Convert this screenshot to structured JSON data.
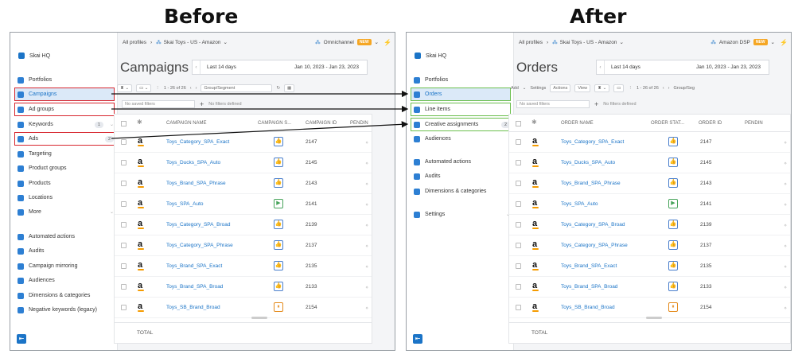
{
  "headings": {
    "before": "Before",
    "after": "After"
  },
  "before": {
    "org": "Skai HQ",
    "sidebar": [
      {
        "label": "Portfolios",
        "icon": "briefcase-icon"
      },
      {
        "label": "Campaigns",
        "icon": "folder-icon",
        "active": true
      },
      {
        "label": "Ad groups",
        "icon": "folders-icon"
      },
      {
        "label": "Keywords",
        "icon": "keyword-icon",
        "count": "1"
      },
      {
        "label": "Ads",
        "icon": "megaphone-icon",
        "count": "2"
      },
      {
        "label": "Targeting",
        "icon": "target-icon"
      },
      {
        "label": "Product groups",
        "icon": "hierarchy-icon"
      },
      {
        "label": "Products",
        "icon": "box-icon"
      },
      {
        "label": "Locations",
        "icon": "pin-icon"
      },
      {
        "label": "More",
        "icon": "more-icon"
      },
      {
        "label": "Automated actions",
        "icon": "robot-icon"
      },
      {
        "label": "Audits",
        "icon": "audit-icon"
      },
      {
        "label": "Campaign mirroring",
        "icon": "mirror-icon"
      },
      {
        "label": "Audiences",
        "icon": "audience-icon"
      },
      {
        "label": "Dimensions & categories",
        "icon": "tag-icon"
      },
      {
        "label": "Negative keywords (legacy)",
        "icon": "negative-icon"
      }
    ],
    "topbar": {
      "all_profiles": "All profiles",
      "account": "Skai Toys - US - Amazon",
      "channel": "Omnichannel",
      "new_badge": "NEW"
    },
    "title": "Campaigns",
    "date": {
      "preset": "Last 14 days",
      "range": "Jan 10, 2023 - Jan 23, 2023"
    },
    "toolbar": {
      "pager": "1 - 26 of 26",
      "group": "Group/Segment"
    },
    "filters": {
      "saved": "No saved filters",
      "defined": "No filters defined"
    },
    "columns": {
      "name": "CAMPAIGN NAME",
      "status": "CAMPAIGN S...",
      "id": "CAMPAIGN ID",
      "pending": "PENDIN"
    },
    "rows": [
      {
        "name": "Toys_Category_SPA_Exact",
        "id": "2147",
        "status": "thumb"
      },
      {
        "name": "Toys_Ducks_SPA_Auto",
        "id": "2145",
        "status": "thumb"
      },
      {
        "name": "Toys_Brand_SPA_Phrase",
        "id": "2143",
        "status": "thumb"
      },
      {
        "name": "Toys_SPA_Auto",
        "id": "2141",
        "status": "play"
      },
      {
        "name": "Toys_Category_SPA_Broad",
        "id": "2139",
        "status": "thumb"
      },
      {
        "name": "Toys_Category_SPA_Phrase",
        "id": "2137",
        "status": "thumb"
      },
      {
        "name": "Toys_Brand_SPA_Exact",
        "id": "2135",
        "status": "thumb"
      },
      {
        "name": "Toys_Brand_SPA_Broad",
        "id": "2133",
        "status": "thumb"
      },
      {
        "name": "Toys_SB_Brand_Broad",
        "id": "2154",
        "status": "pause"
      }
    ],
    "total": "TOTAL"
  },
  "after": {
    "org": "Skai HQ",
    "sidebar": [
      {
        "label": "Portfolios",
        "icon": "briefcase-icon"
      },
      {
        "label": "Orders",
        "icon": "folder-icon",
        "active": true
      },
      {
        "label": "Line items",
        "icon": "folders-icon"
      },
      {
        "label": "Creative assignments",
        "icon": "megaphone-icon",
        "count": "2"
      },
      {
        "label": "Audiences",
        "icon": "audience-icon"
      },
      {
        "label": "Automated actions",
        "icon": "robot-icon"
      },
      {
        "label": "Audits",
        "icon": "audit-icon"
      },
      {
        "label": "Dimensions & categories",
        "icon": "tag-icon"
      },
      {
        "label": "Settings",
        "icon": "settings-icon"
      }
    ],
    "topbar": {
      "all_profiles": "All profiles",
      "account": "Skai Toys - US - Amazon",
      "channel": "Amazon DSP",
      "new_badge": "NEW"
    },
    "title": "Orders",
    "date": {
      "preset": "Last 14 days",
      "range": "Jan 10, 2023 - Jan 23, 2023"
    },
    "toolbar": {
      "add": "Add",
      "settings": "Settings",
      "actions": "Actions",
      "view": "View",
      "pager": "1 - 26 of 26",
      "group": "Group/Seg"
    },
    "filters": {
      "saved": "No saved filters",
      "defined": "No filters defined"
    },
    "columns": {
      "name": "ORDER NAME",
      "status": "ORDER STAT...",
      "id": "ORDER ID",
      "pending": "PENDIN"
    },
    "rows": [
      {
        "name": "Toys_Category_SPA_Exact",
        "id": "2147",
        "status": "thumb"
      },
      {
        "name": "Toys_Ducks_SPA_Auto",
        "id": "2145",
        "status": "thumb"
      },
      {
        "name": "Toys_Brand_SPA_Phrase",
        "id": "2143",
        "status": "thumb"
      },
      {
        "name": "Toys_SPA_Auto",
        "id": "2141",
        "status": "play"
      },
      {
        "name": "Toys_Category_SPA_Broad",
        "id": "2139",
        "status": "thumb"
      },
      {
        "name": "Toys_Category_SPA_Phrase",
        "id": "2137",
        "status": "thumb"
      },
      {
        "name": "Toys_Brand_SPA_Exact",
        "id": "2135",
        "status": "thumb"
      },
      {
        "name": "Toys_Brand_SPA_Broad",
        "id": "2133",
        "status": "thumb"
      },
      {
        "name": "Toys_SB_Brand_Broad",
        "id": "2154",
        "status": "pause"
      }
    ],
    "total": "TOTAL"
  }
}
